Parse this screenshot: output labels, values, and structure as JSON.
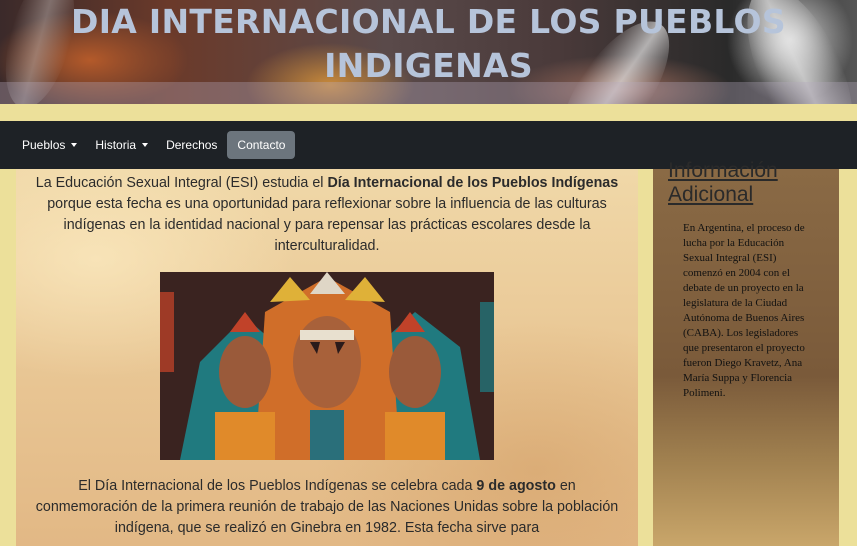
{
  "banner": {
    "title_line1": "DIA INTERNACIONAL DE LOS PUEBLOS",
    "title_line2": "INDIGENAS"
  },
  "navbar": {
    "items": [
      {
        "label": "Pueblos",
        "dropdown": true
      },
      {
        "label": "Historia",
        "dropdown": true
      },
      {
        "label": "Derechos",
        "dropdown": false
      },
      {
        "label": "Contacto",
        "dropdown": false,
        "active": true
      }
    ]
  },
  "main": {
    "intro_part1": "La Educación Sexual Integral (ESI) estudia el ",
    "intro_bold": "Día Internacional de los Pueblos Indígenas",
    "intro_part2": " porque esta fecha es una oportunidad para reflexionar sobre la influencia de las culturas indígenas en la identidad nacional y para repensar las prácticas escolares desde la interculturalidad.",
    "image_icon": "indigenous-people-illustration",
    "second_part1": "El Día Internacional de los Pueblos Indígenas se celebra cada ",
    "second_bold": "9 de agosto",
    "second_part2": " en conmemoración de la primera reunión de trabajo de las Naciones Unidas sobre la población indígena, que se realizó en Ginebra en 1982. Esta fecha sirve para"
  },
  "sidebar": {
    "heading": "Información Adicional",
    "text": "En Argentina, el proceso de lucha por la Educación Sexual Integral (ESI) comenzó en 2004 con el debate de un proyecto en la legislatura de la Ciudad Autónoma de Buenos Aires (CABA). Los legisladores que presentaron el proyecto fueron Diego Kravetz, Ana María Suppa y Florencia Polimeni."
  },
  "colors": {
    "navbar_bg": "#1e2226",
    "active_pill": "#6c757d",
    "page_bg": "#ece09a",
    "title_color": "#b6c4da"
  }
}
